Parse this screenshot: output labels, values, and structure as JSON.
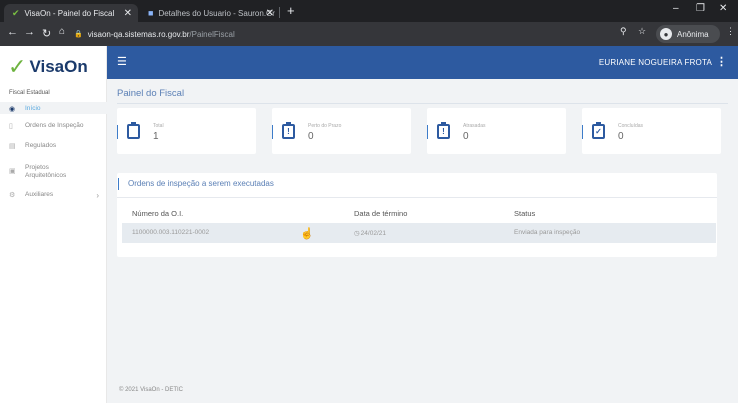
{
  "browser": {
    "tabs": [
      {
        "title": "VisaOn - Painel do Fiscal",
        "active": true
      },
      {
        "title": "Detalhes do Usuario - Sauron.Gr",
        "active": false
      }
    ],
    "new_tab": "+",
    "url_host": "visaon-qa.sistemas.ro.gov.br",
    "url_path": "/PainelFiscal",
    "profile_label": "Anônima"
  },
  "sidebar": {
    "logo_text": "VisaOn",
    "section_label": "Fiscal Estadual",
    "items": [
      {
        "label": "Início",
        "icon": "dashboard-icon",
        "active": true
      },
      {
        "label": "Ordens de Inspeção",
        "icon": "document-icon",
        "active": false
      },
      {
        "label": "Regulados",
        "icon": "building-icon",
        "active": false
      },
      {
        "label": "Projetos Arquitetônicos",
        "icon": "blueprint-icon",
        "active": false
      },
      {
        "label": "Auxiliares",
        "icon": "gears-icon",
        "active": false
      }
    ]
  },
  "appbar": {
    "user_name": "EURIANE NOGUEIRA FROTA"
  },
  "main": {
    "page_title": "Painel do Fiscal",
    "cards": [
      {
        "label": "Total",
        "value": "1",
        "icon": "clipboard-icon"
      },
      {
        "label": "Perto do Prazo",
        "value": "0",
        "icon": "clipboard-alert-icon"
      },
      {
        "label": "Atrasadas",
        "value": "0",
        "icon": "clipboard-alert-icon"
      },
      {
        "label": "Concluídas",
        "value": "0",
        "icon": "clipboard-check-icon"
      }
    ],
    "orders": {
      "title": "Ordens de inspeção a serem executadas",
      "columns": [
        "Número da O.I.",
        "Data de término",
        "Status"
      ],
      "rows": [
        {
          "numero": "1100000.003.110221-0002",
          "data": "24/02/21",
          "status": "Enviada para inspeção"
        }
      ]
    },
    "footer": "© 2021 VisaOn - DETIC"
  },
  "colors": {
    "brand_blue": "#2d5aa0",
    "brand_green": "#6db33f",
    "logo_navy": "#1b3a6b",
    "accent_title": "#5a7fb5"
  }
}
